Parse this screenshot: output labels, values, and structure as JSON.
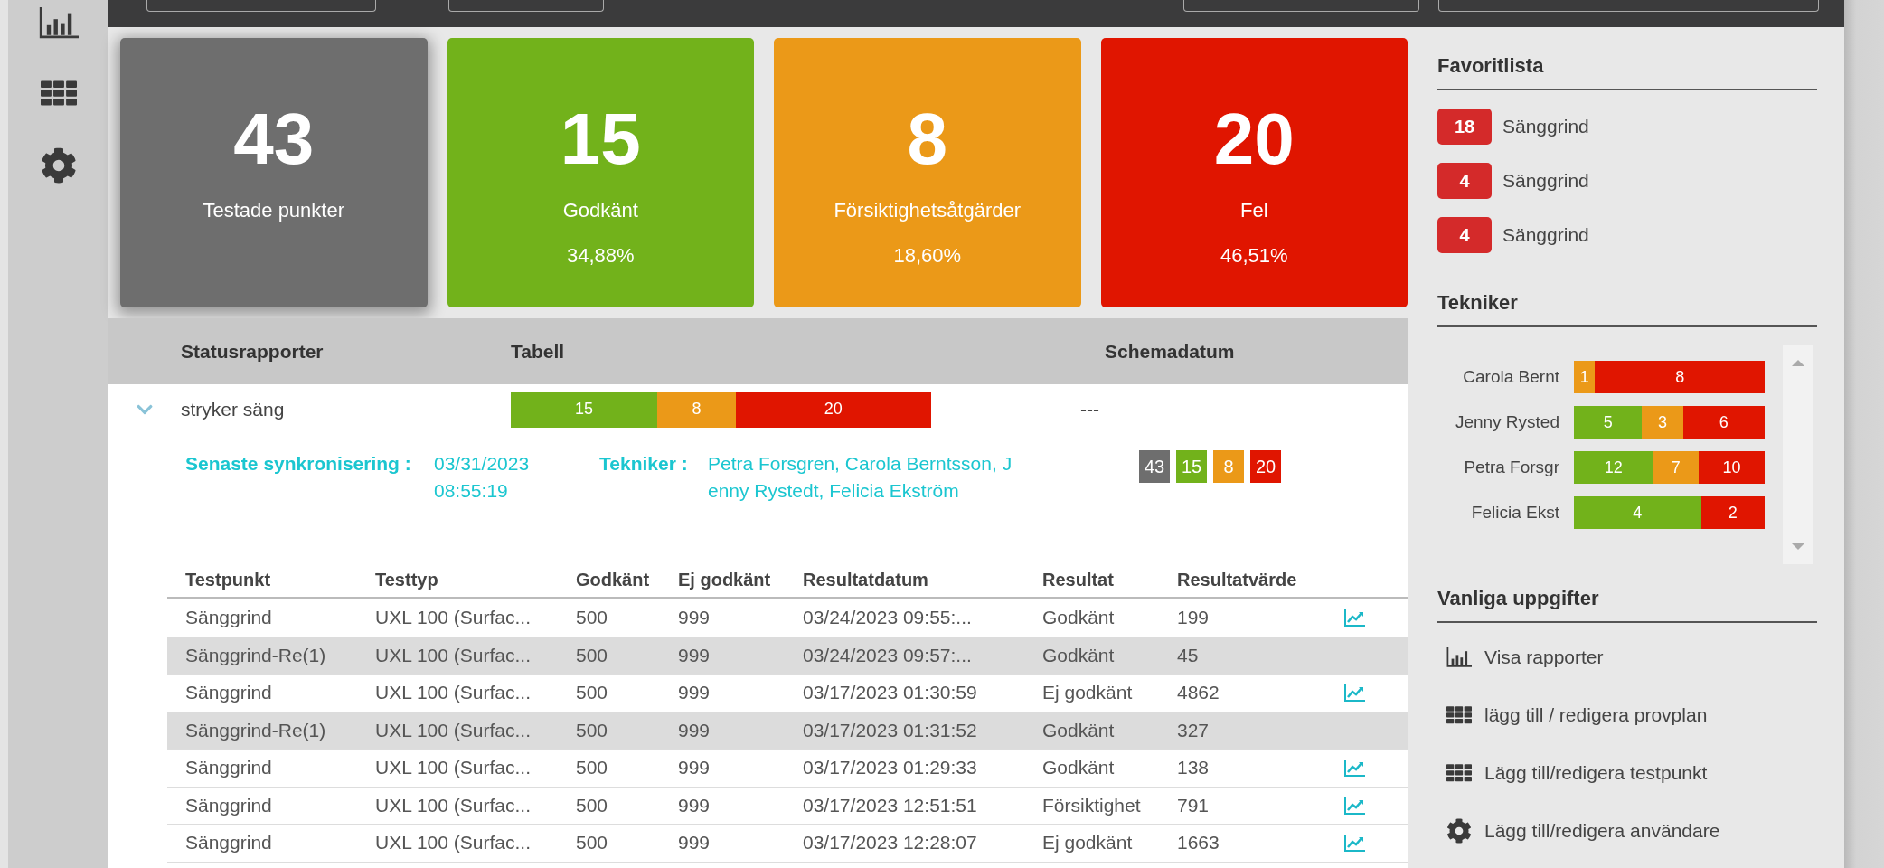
{
  "nav": [
    {
      "kind": "chart"
    },
    {
      "kind": "grid"
    },
    {
      "kind": "gear"
    }
  ],
  "cards": [
    {
      "number": "43",
      "label": "Testade punkter",
      "color": "#6e6e6e",
      "selected": true
    },
    {
      "number": "15",
      "label": "Godkänt",
      "percent": "34,88%",
      "color": "#72b21b",
      "selected": false
    },
    {
      "number": "8",
      "label": "Försiktighetsåtgärder",
      "percent": "18,60%",
      "color": "#eb9918",
      "selected": false
    },
    {
      "number": "20",
      "label": "Fel",
      "percent": "46,51%",
      "color": "#e01500",
      "selected": false
    }
  ],
  "report_table": {
    "columns": [
      "Statusrapporter",
      "Tabell",
      "Schemadatum"
    ],
    "group": {
      "name": "stryker säng",
      "expanded": true,
      "schedule_date": "---",
      "segments": [
        {
          "value": "15",
          "color": "#72b21b"
        },
        {
          "value": "8",
          "color": "#eb9918"
        },
        {
          "value": "20",
          "color": "#e01500"
        }
      ],
      "sync_label": "Senaste synkronisering :",
      "sync_value": "03/31/2023 08:55:19",
      "technicians_label": "Tekniker :",
      "technicians_value": "Petra Forsgren, Carola Berntsson, Jenny Rystedt, Felicia Ekström",
      "counts": [
        {
          "value": "43",
          "color": "#6e6e6e"
        },
        {
          "value": "15",
          "color": "#72b21b"
        },
        {
          "value": "8",
          "color": "#eb9918"
        },
        {
          "value": "20",
          "color": "#e01500"
        }
      ],
      "columns": [
        "Testpunkt",
        "Testtyp",
        "Godkänt",
        "Ej godkänt",
        "Resultatdatum",
        "Resultat",
        "Resultatvärde"
      ],
      "rows": [
        {
          "cells": [
            "Sänggrind",
            "UXL 100 (Surfac...",
            "500",
            "999",
            "03/24/2023 09:55:...",
            "Godkänt",
            "199"
          ],
          "highlighted": false,
          "graph": true
        },
        {
          "cells": [
            "Sänggrind-Re(1)",
            "UXL 100 (Surfac...",
            "500",
            "999",
            "03/24/2023 09:57:...",
            "Godkänt",
            "45"
          ],
          "highlighted": true,
          "graph": false
        },
        {
          "cells": [
            "Sänggrind",
            "UXL 100 (Surfac...",
            "500",
            "999",
            "03/17/2023 01:30:59",
            "Ej godkänt",
            "4862"
          ],
          "highlighted": false,
          "graph": true
        },
        {
          "cells": [
            "Sänggrind-Re(1)",
            "UXL 100 (Surfac...",
            "500",
            "999",
            "03/17/2023 01:31:52",
            "Godkänt",
            "327"
          ],
          "highlighted": true,
          "graph": false
        },
        {
          "cells": [
            "Sänggrind",
            "UXL 100 (Surfac...",
            "500",
            "999",
            "03/17/2023 01:29:33",
            "Godkänt",
            "138"
          ],
          "highlighted": false,
          "graph": true
        },
        {
          "cells": [
            "Sänggrind",
            "UXL 100 (Surfac...",
            "500",
            "999",
            "03/17/2023 12:51:51",
            "Försiktighet",
            "791"
          ],
          "highlighted": false,
          "graph": true
        },
        {
          "cells": [
            "Sänggrind",
            "UXL 100 (Surfac...",
            "500",
            "999",
            "03/17/2023 12:28:07",
            "Ej godkänt",
            "1663"
          ],
          "highlighted": false,
          "graph": true
        }
      ]
    }
  },
  "favorites": {
    "title": "Favoritlista",
    "items": [
      {
        "count": "18",
        "label": "Sänggrind"
      },
      {
        "count": "4",
        "label": "Sänggrind"
      },
      {
        "count": "4",
        "label": "Sänggrind"
      }
    ]
  },
  "technicians": {
    "title": "Tekniker",
    "rows": [
      {
        "name": "Carola Bernt",
        "segments": [
          {
            "value": "1",
            "color": "#eb9918"
          },
          {
            "value": "8",
            "color": "#e01500"
          }
        ]
      },
      {
        "name": "Jenny Rysted",
        "segments": [
          {
            "value": "5",
            "color": "#72b21b"
          },
          {
            "value": "3",
            "color": "#eb9918"
          },
          {
            "value": "6",
            "color": "#e01500"
          }
        ]
      },
      {
        "name": "Petra Forsgr",
        "segments": [
          {
            "value": "12",
            "color": "#72b21b"
          },
          {
            "value": "7",
            "color": "#eb9918"
          },
          {
            "value": "10",
            "color": "#e01500"
          }
        ]
      },
      {
        "name": "Felicia Ekst",
        "segments": [
          {
            "value": "4",
            "color": "#72b21b"
          },
          {
            "value": "2",
            "color": "#e01500"
          }
        ]
      }
    ]
  },
  "tasks": {
    "title": "Vanliga uppgifter",
    "items": [
      {
        "kind": "chart",
        "label": "Visa rapporter"
      },
      {
        "kind": "grid",
        "label": "lägg till / redigera provplan"
      },
      {
        "kind": "grid",
        "label": "Lägg till/redigera testpunkt"
      },
      {
        "kind": "gear",
        "label": "Lägg till/redigera användare"
      }
    ]
  }
}
